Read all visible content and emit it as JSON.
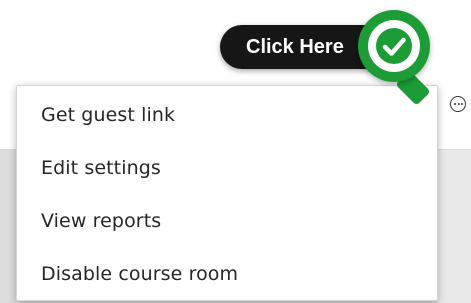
{
  "menu": {
    "items": [
      "Get guest link",
      "Edit settings",
      "View reports",
      "Disable course room"
    ]
  },
  "callout": {
    "label": "Click Here",
    "icon": "check-icon",
    "accent_color": "#1c9b37"
  },
  "more_options_icon": "more-options-icon"
}
